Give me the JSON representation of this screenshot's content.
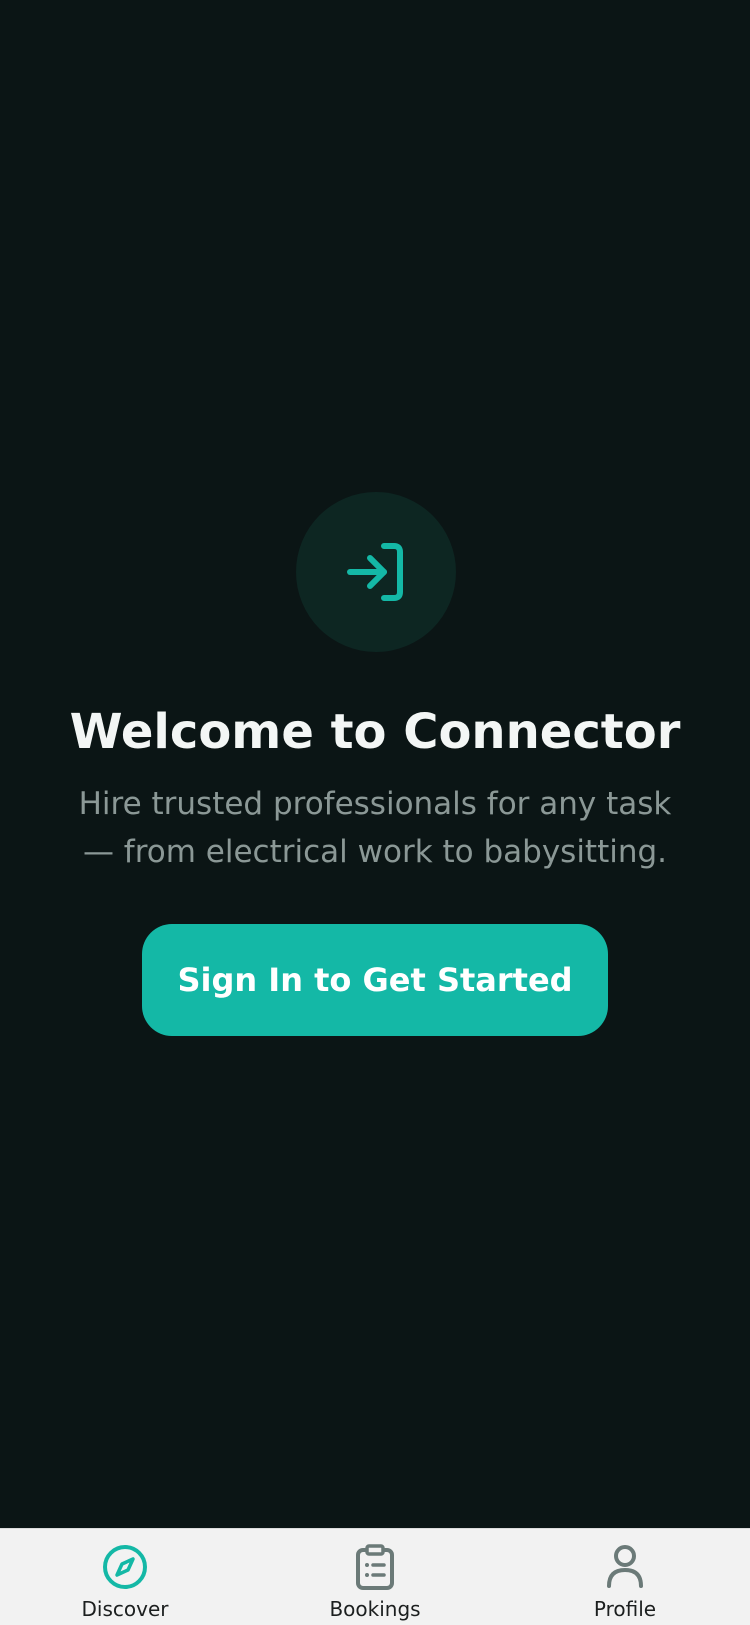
{
  "welcome": {
    "title": "Welcome to Connector",
    "subtitle_line1": "Hire trusted professionals for any task",
    "subtitle_line2": "— from electrical work to babysitting.",
    "cta_label": "Sign In to Get Started",
    "hero_icon": "sign-in-icon"
  },
  "tabs": [
    {
      "label": "Discover",
      "icon": "compass-icon",
      "active": true
    },
    {
      "label": "Bookings",
      "icon": "clipboard-icon",
      "active": false
    },
    {
      "label": "Profile",
      "icon": "person-icon",
      "active": false
    }
  ],
  "colors": {
    "background": "#0b1515",
    "accent": "#14b8a6",
    "icon_circle": "#0d2622",
    "tabbar": "#f2f2f2",
    "inactive_icon": "#6b7a78"
  }
}
